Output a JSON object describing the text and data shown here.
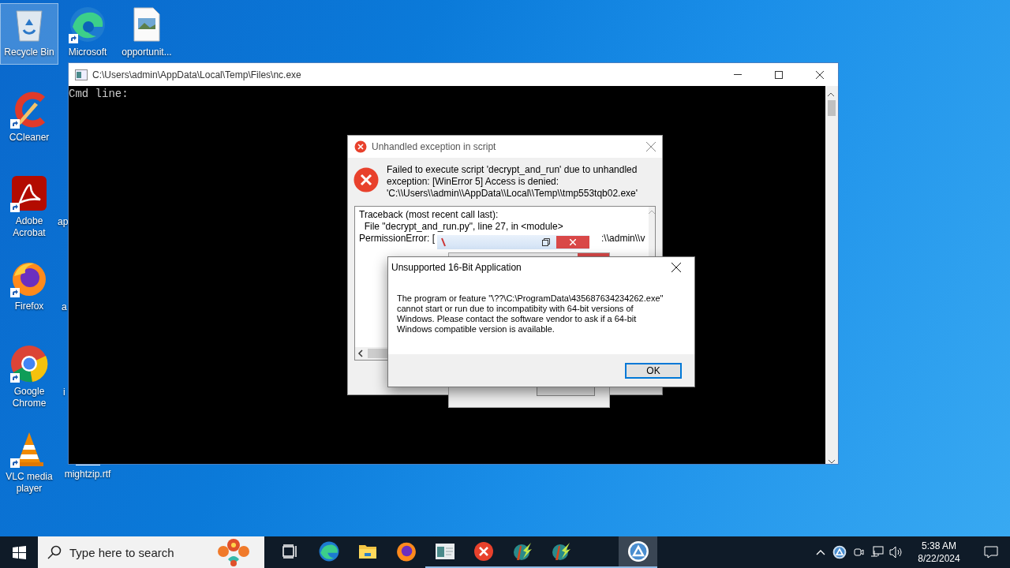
{
  "desktop": {
    "icons": [
      {
        "label": "Recycle Bin",
        "kind": "recycle",
        "shortcut": false,
        "selected": true
      },
      {
        "label": "Microsoft",
        "kind": "edge",
        "shortcut": true,
        "selected": false
      },
      {
        "label": "opportunit...",
        "kind": "image",
        "shortcut": false,
        "selected": false
      },
      {
        "label": "CCleaner",
        "kind": "ccleaner",
        "shortcut": true,
        "selected": false
      },
      {
        "label": "Adobe Acrobat",
        "kind": "acrobat",
        "shortcut": true,
        "selected": false
      },
      {
        "label": "ap",
        "kind": "hidden"
      },
      {
        "label": "Firefox",
        "kind": "firefox",
        "shortcut": true,
        "selected": false
      },
      {
        "label": "a",
        "kind": "hidden"
      },
      {
        "label": "Google Chrome",
        "kind": "chrome",
        "shortcut": true,
        "selected": false
      },
      {
        "label": "i",
        "kind": "hidden"
      },
      {
        "label": "VLC media player",
        "kind": "vlc",
        "shortcut": true,
        "selected": false
      },
      {
        "label": "mightzip.rtf",
        "kind": "document",
        "shortcut": false,
        "selected": false
      }
    ]
  },
  "console_window": {
    "title": "C:\\Users\\admin\\AppData\\Local\\Temp\\Files\\nc.exe",
    "text": "Cmd line:"
  },
  "exception_dialog": {
    "title": "Unhandled exception in script",
    "message_lines": [
      "Failed to execute script 'decrypt_and_run' due to unhandled",
      "exception: [WinError 5] Access is denied:",
      "'C:\\\\Users\\\\admin\\\\AppData\\\\Local\\\\Temp\\\\tmp553tqb02.exe'"
    ],
    "traceback_lines": [
      "Traceback (most recent call last):",
      "  File \"decrypt_and_run.py\", line 27, in <module>"
    ],
    "error_line_start": "PermissionError: [",
    "error_line_end": ":\\\\admin\\\\v"
  },
  "unsupported_dialog": {
    "title": "Unsupported 16-Bit Application",
    "message_lines": [
      "The program or feature \"\\??\\C:\\ProgramData\\435687634234262.exe\"",
      "cannot start or run due to incompatibity with 64-bit versions of",
      "Windows. Please contact the software vendor to ask if a 64-bit",
      "Windows compatible version is available."
    ],
    "button": "OK"
  },
  "taskbar": {
    "search_placeholder": "Type here to search",
    "apps": [
      {
        "kind": "taskview",
        "running": false,
        "active": false
      },
      {
        "kind": "edge",
        "running": false,
        "active": false
      },
      {
        "kind": "folder",
        "running": false,
        "active": false
      },
      {
        "kind": "firefox",
        "running": false,
        "active": false
      },
      {
        "kind": "console",
        "running": true,
        "active": false
      },
      {
        "kind": "error",
        "running": true,
        "active": false
      },
      {
        "kind": "bolt",
        "running": true,
        "active": false
      },
      {
        "kind": "bolt",
        "running": true,
        "active": false
      },
      {
        "kind": "blank",
        "running": true,
        "active": false
      },
      {
        "kind": "autoit",
        "running": true,
        "active": true
      }
    ],
    "time": "5:38 AM",
    "date": "8/22/2024"
  }
}
